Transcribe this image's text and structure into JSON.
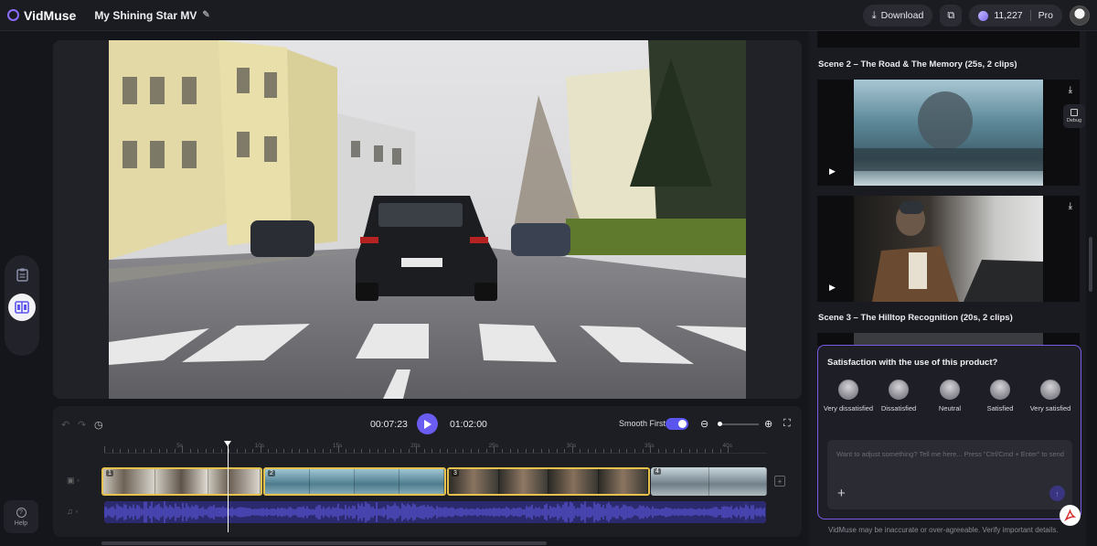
{
  "app": {
    "name": "VidMuse",
    "project_title": "My Shining Star MV"
  },
  "topbar": {
    "download_label": "Download",
    "credits": "11,227",
    "plan": "Pro"
  },
  "sidebar": {
    "help_label": "Help"
  },
  "player": {
    "current_time": "00:07:23",
    "total_time": "01:02:00",
    "smooth_label": "Smooth First",
    "smooth_enabled": true
  },
  "timeline": {
    "ruler_labels": [
      "5s",
      "10s",
      "15s",
      "20s",
      "25s",
      "30s",
      "35s",
      "40s"
    ],
    "clips": [
      {
        "num": "1",
        "selected": true
      },
      {
        "num": "2",
        "selected": true
      },
      {
        "num": "3",
        "selected": true
      },
      {
        "num": "4",
        "selected": false
      }
    ]
  },
  "panel": {
    "scenes": [
      {
        "title": "Scene 2 – The Road & The Memory (25s, 2 clips)"
      },
      {
        "title": "Scene 3 – The Hilltop Recognition (20s, 2 clips)"
      }
    ],
    "debug_label": "Debug"
  },
  "survey": {
    "question": "Satisfaction with the use of this product?",
    "options": [
      "Very dissatisfied",
      "Dissatisfied",
      "Neutral",
      "Satisfied",
      "Very satisfied"
    ]
  },
  "chat": {
    "placeholder": "Want to adjust something? Tell me here... Press \"Ctrl/Cmd + Enter\" to send"
  },
  "disclaimer": "VidMuse may be inaccurate or over-agreeable. Verify important details.",
  "colors": {
    "accent": "#6a5cf0",
    "clip_selected": "#e6c24c",
    "audio": "#2c2a6e"
  }
}
